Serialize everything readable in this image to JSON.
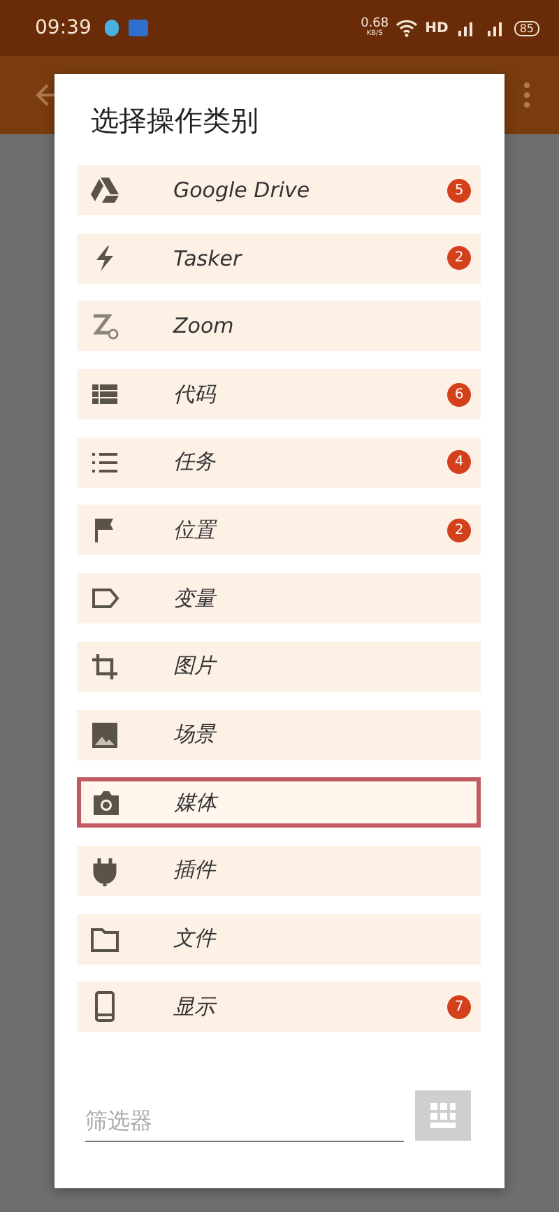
{
  "status_bar": {
    "time": "09:39",
    "speed": "0.68",
    "speed_unit": "KB/S",
    "hd": "HD",
    "battery": "85"
  },
  "dialog": {
    "title": "选择操作类别",
    "items": [
      {
        "label": "Google Drive",
        "badge": "5",
        "selected": false
      },
      {
        "label": "Tasker",
        "badge": "2",
        "selected": false
      },
      {
        "label": "Zoom",
        "selected": false
      },
      {
        "label": "代码",
        "badge": "6",
        "selected": false
      },
      {
        "label": "任务",
        "badge": "4",
        "selected": false
      },
      {
        "label": "位置",
        "badge": "2",
        "selected": false
      },
      {
        "label": "变量",
        "selected": false
      },
      {
        "label": "图片",
        "selected": false
      },
      {
        "label": "场景",
        "selected": false
      },
      {
        "label": "媒体",
        "selected": true
      },
      {
        "label": "插件",
        "selected": false
      },
      {
        "label": "文件",
        "selected": false
      },
      {
        "label": "显示",
        "badge": "7",
        "selected": false
      }
    ],
    "filter": {
      "placeholder": "筛选器"
    }
  }
}
